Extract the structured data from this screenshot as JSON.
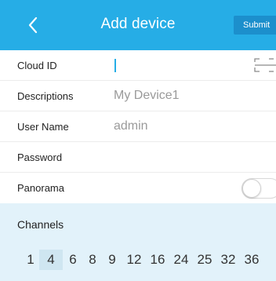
{
  "header": {
    "title": "Add device",
    "submit_label": "Submit",
    "background_color": "#26ade6"
  },
  "form": {
    "cloud_id": {
      "label": "Cloud ID",
      "value": ""
    },
    "descriptions": {
      "label": "Descriptions",
      "placeholder": "My Device1"
    },
    "user_name": {
      "label": "User Name",
      "placeholder": "admin"
    },
    "password": {
      "label": "Password",
      "value": ""
    },
    "panorama": {
      "label": "Panorama",
      "enabled": false
    }
  },
  "channels": {
    "label": "Channels",
    "options": [
      "1",
      "4",
      "6",
      "8",
      "9",
      "12",
      "16",
      "24",
      "25",
      "32",
      "36"
    ],
    "selected": "4"
  },
  "icons": {
    "back": "chevron-left-icon",
    "scan": "qr-scan-icon"
  }
}
